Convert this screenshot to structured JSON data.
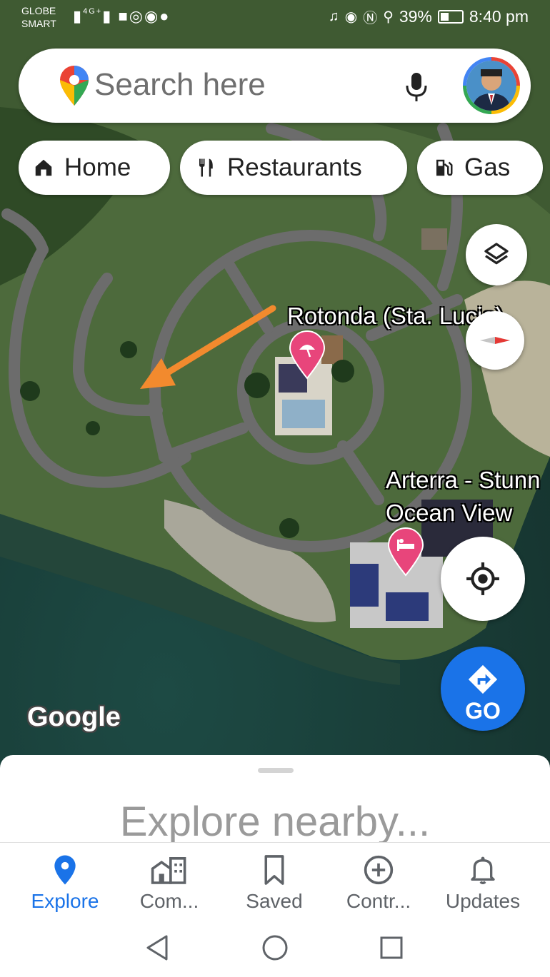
{
  "status_bar": {
    "carrier_line1": "GLOBE",
    "carrier_line2": "SMART",
    "network": "4G+",
    "battery": "39%",
    "time": "8:40 pm"
  },
  "search": {
    "placeholder": "Search here"
  },
  "chips": [
    {
      "label": "Home",
      "icon": "home-icon"
    },
    {
      "label": "Restaurants",
      "icon": "fork-knife-icon"
    },
    {
      "label": "Gas",
      "icon": "gas-pump-icon"
    }
  ],
  "map": {
    "places": [
      {
        "name": "Rotonda (Sta. Lucia)",
        "icon": "beach-umbrella-icon",
        "color": "#e8457b"
      },
      {
        "name_line1": "Arterra - Stunn",
        "name_line2": "Ocean View",
        "icon": "hotel-bed-icon",
        "color": "#e8457b"
      }
    ],
    "watermark": "Google",
    "annotation_arrow_color": "#f28a2e"
  },
  "controls": {
    "layers": "layers-icon",
    "compass": "compass-icon",
    "my_location": "my-location-icon",
    "go_label": "GO",
    "go_color": "#1a73e8"
  },
  "sheet": {
    "title": "Explore nearby..."
  },
  "bottom_nav": [
    {
      "label": "Explore",
      "icon": "location-pin-icon",
      "active": true
    },
    {
      "label": "Com...",
      "icon": "commute-icon",
      "active": false
    },
    {
      "label": "Saved",
      "icon": "bookmark-icon",
      "active": false
    },
    {
      "label": "Contr...",
      "icon": "add-circle-icon",
      "active": false
    },
    {
      "label": "Updates",
      "icon": "bell-icon",
      "active": false
    }
  ],
  "accent_color": "#1a73e8"
}
